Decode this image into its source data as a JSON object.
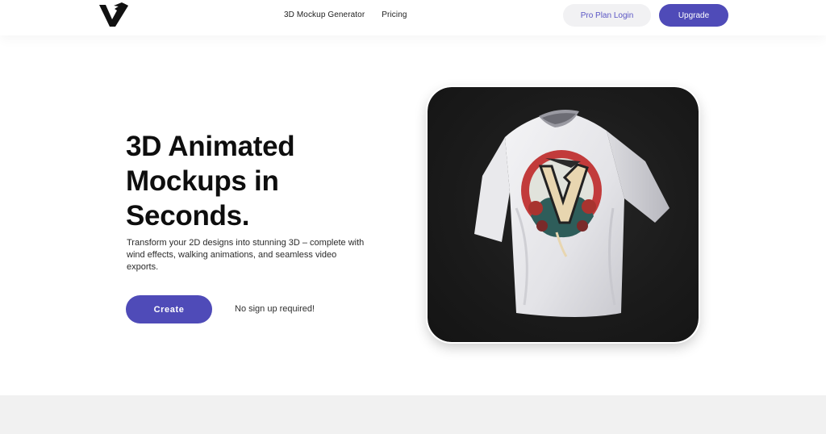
{
  "brand": {
    "logo_icon": "v-logo-icon",
    "colors": {
      "accent": "#4f4bb8",
      "login_bg": "#f1f1f3",
      "login_text": "#5b56c4",
      "footer_band": "#f1f1f1"
    }
  },
  "nav": {
    "links": [
      {
        "label": "3D Mockup Generator"
      },
      {
        "label": "Pricing"
      }
    ],
    "login_label": "Pro Plan Login",
    "upgrade_label": "Upgrade"
  },
  "hero": {
    "title_lines": [
      "3D Animated",
      "Mockups in",
      "Seconds."
    ],
    "description": "Transform your 2D designs into stunning 3D – complete with wind effects, walking animations, and seamless video exports.",
    "cta_label": "Create",
    "cta_note": "No sign up required!"
  },
  "mockup": {
    "subject": "white-tshirt-3d-mockup",
    "card_bg": "#1b1b1b"
  }
}
